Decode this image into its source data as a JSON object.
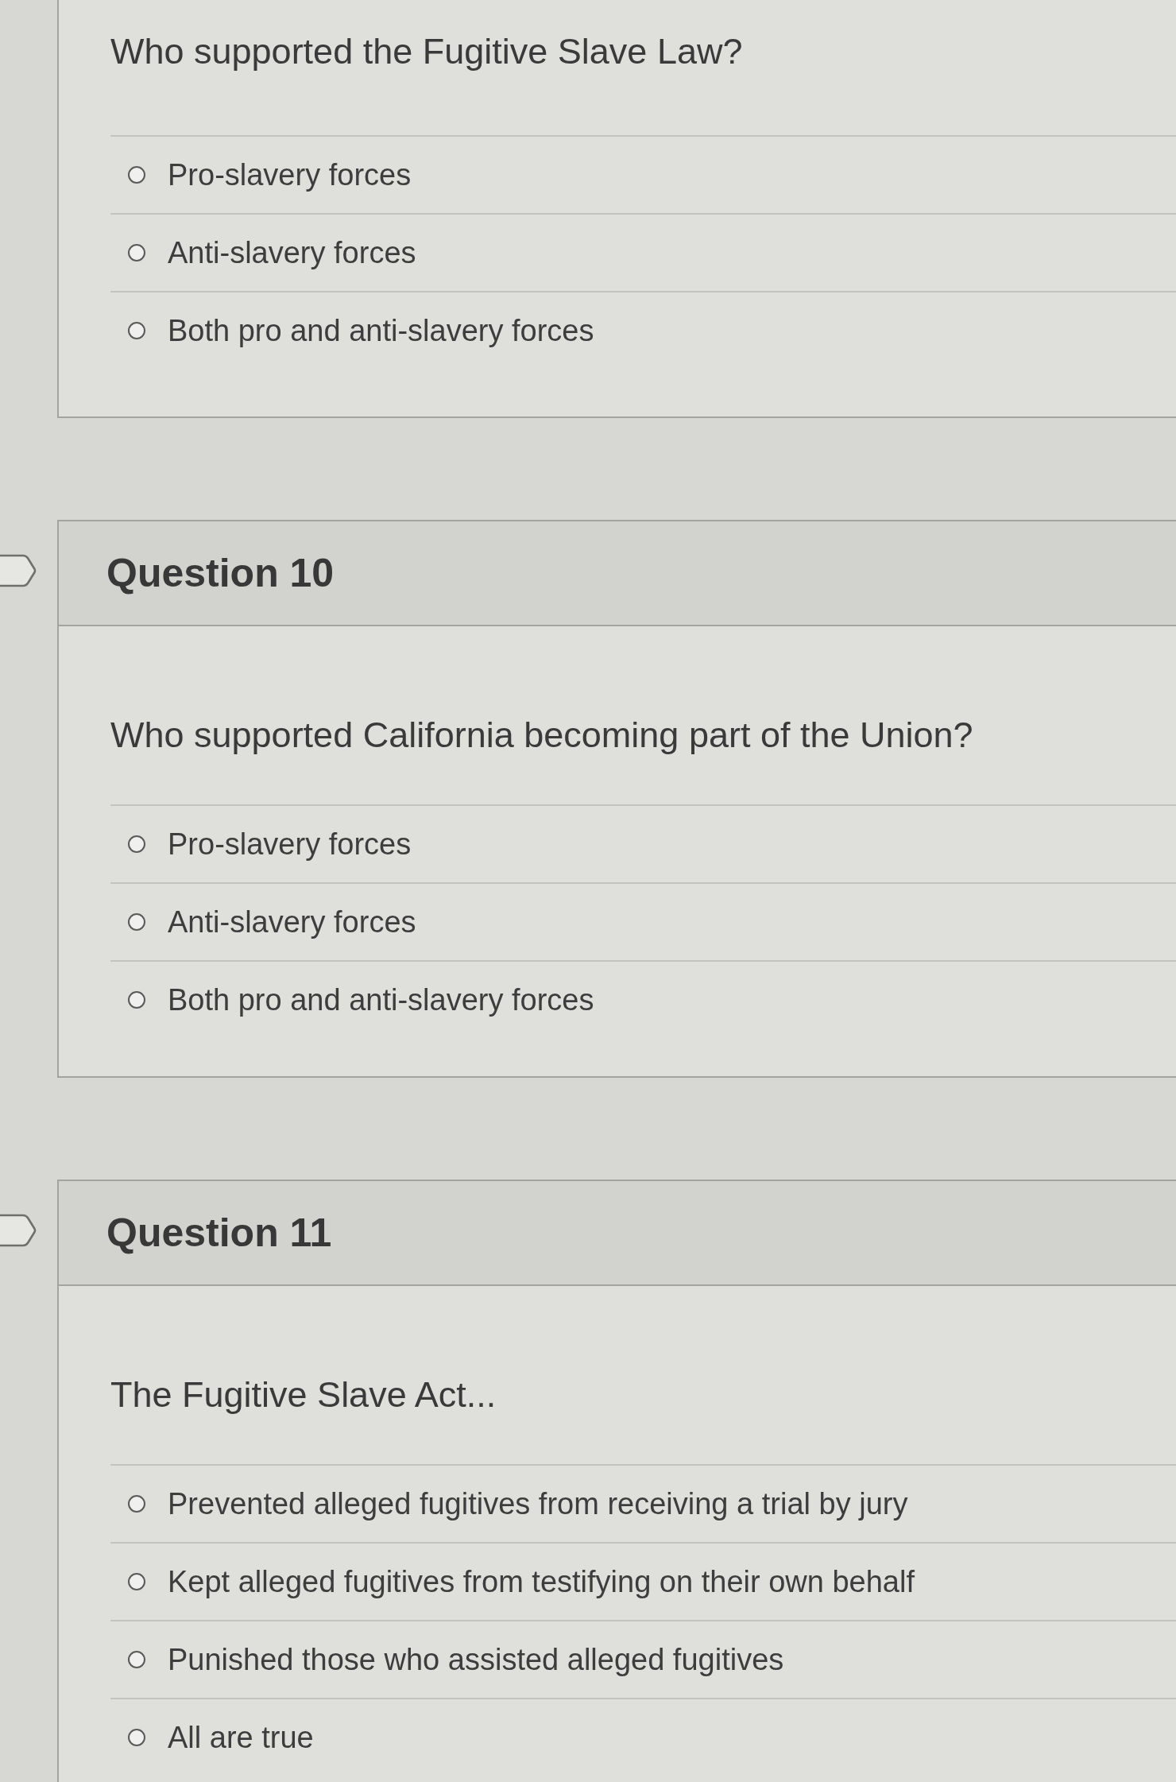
{
  "questions": [
    {
      "prompt": "Who supported the Fugitive Slave Law?",
      "options": [
        {
          "label": "Pro-slavery forces",
          "selected": false
        },
        {
          "label": "Anti-slavery forces",
          "selected": false
        },
        {
          "label": "Both pro and anti-slavery forces",
          "selected": false
        }
      ]
    },
    {
      "title": "Question 10",
      "prompt": "Who supported California becoming part of the Union?",
      "options": [
        {
          "label": "Pro-slavery forces",
          "selected": false
        },
        {
          "label": "Anti-slavery forces",
          "selected": false
        },
        {
          "label": "Both pro and anti-slavery forces",
          "selected": false
        }
      ]
    },
    {
      "title": "Question 11",
      "prompt": "The Fugitive Slave Act...",
      "options": [
        {
          "label": "Prevented alleged fugitives from receiving a trial by jury",
          "selected": false
        },
        {
          "label": "Kept alleged fugitives from testifying on their own behalf",
          "selected": false
        },
        {
          "label": "Punished those who assisted alleged fugitives",
          "selected": false
        },
        {
          "label": "All are true",
          "selected": false
        }
      ]
    }
  ]
}
